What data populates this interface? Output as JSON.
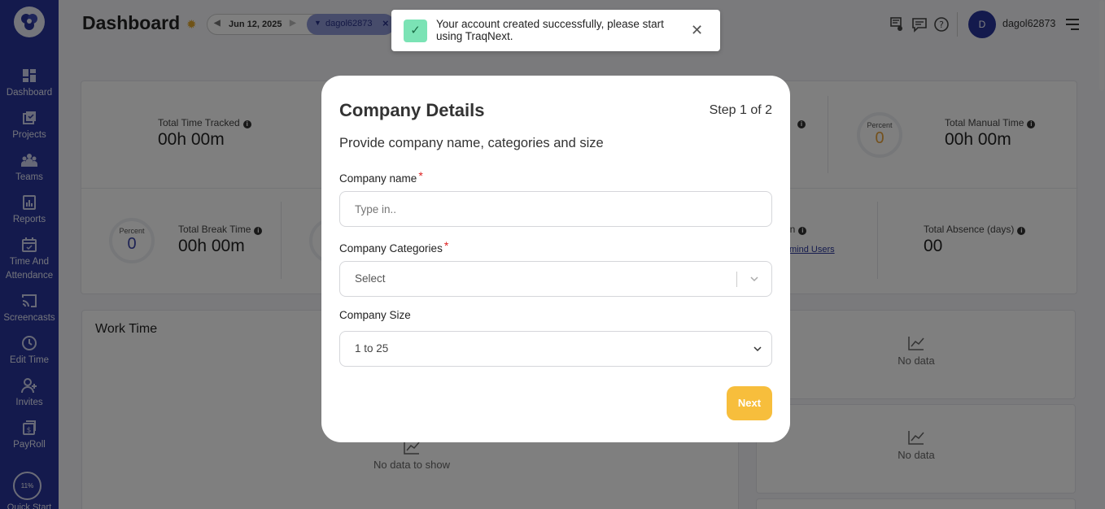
{
  "sidebar": {
    "items": [
      {
        "label": "Dashboard",
        "icon": "dashboard-icon"
      },
      {
        "label": "Projects",
        "icon": "projects-icon"
      },
      {
        "label": "Teams",
        "icon": "teams-icon"
      },
      {
        "label": "Reports",
        "icon": "reports-icon"
      },
      {
        "label": "Time And Attendance",
        "icon": "calendar-icon"
      },
      {
        "label": "Screencasts",
        "icon": "cast-icon"
      },
      {
        "label": "Edit Time",
        "icon": "clock-icon"
      },
      {
        "label": "Invites",
        "icon": "add-user-icon"
      },
      {
        "label": "PayRoll",
        "icon": "payroll-icon"
      }
    ],
    "quick_start_percent": "11%",
    "quick_start_label": "Quick Start"
  },
  "header": {
    "title": "Dashboard",
    "date": "Jun 12, 2025",
    "user_filter": "dagol62873",
    "username": "dagol62873",
    "avatar_initial": "D"
  },
  "stats": {
    "total_time_tracked_label": "Total Time Tracked",
    "total_time_tracked_value": "00h 00m",
    "manual_percent_label": "Percent",
    "manual_percent_value": "0",
    "total_manual_time_label": "Total Manual Time",
    "total_manual_time_value": "00h 00m",
    "break_percent_label": "Percent",
    "break_percent_value": "0",
    "total_break_time_label": "Total Break Time",
    "total_break_time_value": "00h 00m",
    "partial_label": "on",
    "remind_users": "mind Users",
    "total_absence_label": "Total Absence (days)",
    "total_absence_value": "00"
  },
  "panels": {
    "work_time_title": "Work Time",
    "no_data_to_show": "No data to show",
    "no_data": "No data"
  },
  "toast": {
    "message": "Your account created successfully, please start using TraqNext."
  },
  "modal": {
    "title": "Company Details",
    "step": "Step 1 of 2",
    "subtitle": "Provide company name, categories and size",
    "company_name_label": "Company name",
    "company_name_placeholder": "Type in..",
    "company_categories_label": "Company Categories",
    "company_categories_placeholder": "Select",
    "company_size_label": "Company Size",
    "company_size_value": "1 to 25",
    "next_label": "Next"
  },
  "colors": {
    "sidebar": "#28349a",
    "accent": "#f7be3c",
    "toast_check": "#7be3b5"
  }
}
